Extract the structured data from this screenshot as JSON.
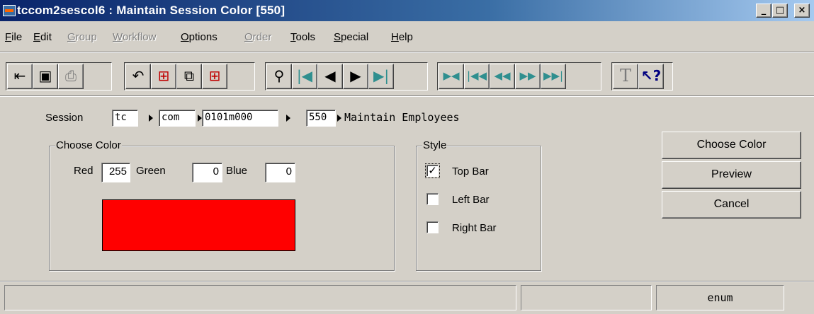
{
  "window": {
    "title": "tccom2sescol6 : Maintain Session Color [550]",
    "controls": {
      "minimize": "_",
      "maximize": "□",
      "close": "×"
    }
  },
  "menubar": {
    "items": [
      {
        "label": "File",
        "accel": "F",
        "rest": "ile",
        "enabled": true
      },
      {
        "label": "Edit",
        "accel": "E",
        "rest": "dit",
        "enabled": true
      },
      {
        "label": "Group",
        "accel": "G",
        "rest": "roup",
        "enabled": false
      },
      {
        "label": "Workflow",
        "accel": "W",
        "rest": "orkflow",
        "enabled": false
      },
      {
        "label": "Options",
        "accel": "O",
        "rest": "ptions",
        "enabled": true
      },
      {
        "label": "Order",
        "accel": "O",
        "rest": "rder",
        "enabled": false
      },
      {
        "label": "Tools",
        "accel": "T",
        "rest": "ools",
        "enabled": true
      },
      {
        "label": "Special",
        "accel": "S",
        "rest": "pecial",
        "enabled": true
      },
      {
        "label": "Help",
        "accel": "H",
        "rest": "elp",
        "enabled": true
      }
    ]
  },
  "toolbar": {
    "icons": [
      "exit-icon",
      "save-icon",
      "print-icon",
      "undo-icon",
      "insert-record-icon",
      "copy-icon",
      "duplicate-record-icon",
      "find-icon",
      "first-record-icon",
      "previous-record-icon",
      "next-record-icon",
      "last-record-icon",
      "first-group-icon",
      "previous-group-icon",
      "rewind-icon",
      "forward-icon",
      "last-group-icon",
      "text-icon",
      "help-pointer-icon"
    ]
  },
  "session": {
    "label": "Session",
    "package": "tc",
    "module": "com",
    "code": "0101m000",
    "number": "550",
    "description": "Maintain Employees"
  },
  "choose_color": {
    "title": "Choose Color",
    "red_label": "Red",
    "red": "255",
    "green_label": "Green",
    "green": "0",
    "blue_label": "Blue",
    "blue": "0",
    "swatch_color": "#ff0000"
  },
  "style": {
    "title": "Style",
    "options": [
      {
        "label": "Top Bar",
        "checked": true
      },
      {
        "label": "Left Bar",
        "checked": false
      },
      {
        "label": "Right Bar",
        "checked": false
      }
    ]
  },
  "buttons": {
    "choose_color": "Choose Color",
    "preview": "Preview",
    "cancel": "Cancel"
  },
  "statusbar": {
    "field_type": "enum"
  },
  "colors": {
    "title_active": "#0a246a",
    "title_gradient_end": "#a6caf0",
    "face": "#d4d0c8",
    "red_preview": "#ff0000"
  }
}
